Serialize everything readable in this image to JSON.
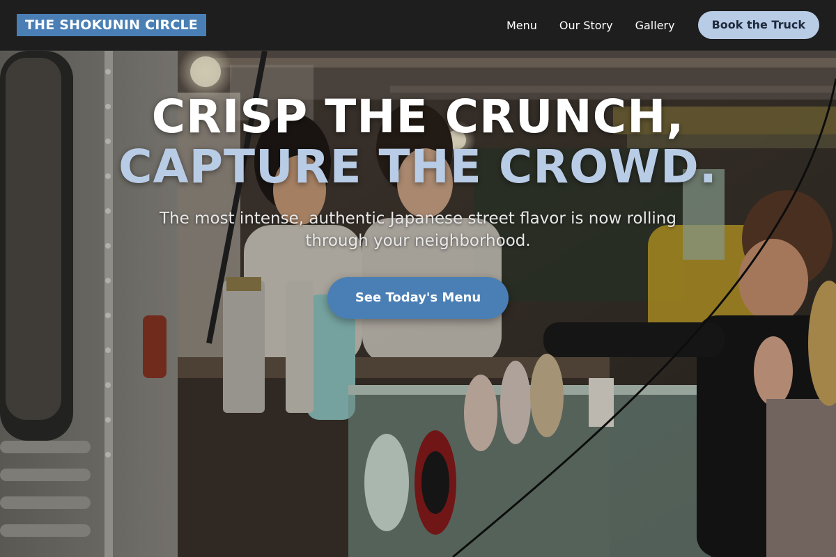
{
  "navbar": {
    "brand": "THE SHOKUNIN CIRCLE",
    "links": [
      "Menu",
      "Our Story",
      "Gallery"
    ],
    "cta_label": "Book the Truck"
  },
  "hero": {
    "headline_line1": "CRISP THE CRUNCH,",
    "headline_line2": "CAPTURE THE CROWD.",
    "subtext": "The most intense, authentic Japanese street flavor is now rolling through your neighborhood.",
    "cta_label": "See Today's Menu",
    "background_image": "food-truck-photo"
  },
  "colors": {
    "brand_blue": "#4a7fb5",
    "accent_light_blue": "#b9cce6",
    "nav_background": "#1e1e1e"
  }
}
